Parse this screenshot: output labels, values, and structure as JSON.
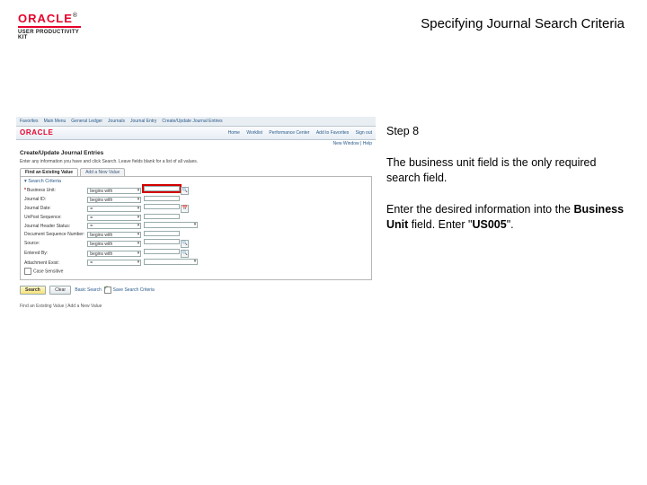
{
  "header": {
    "brand": "ORACLE",
    "kit": "USER PRODUCTIVITY KIT",
    "title": "Specifying Journal Search Criteria"
  },
  "instructions": {
    "step_label": "Step 8",
    "para1": "The business unit field is the only required search field.",
    "para2_a": "Enter the desired information into the ",
    "para2_field": "Business Unit",
    "para2_b": " field. Enter \"",
    "para2_value": "US005",
    "para2_c": "\"."
  },
  "shot": {
    "breadcrumb": [
      "Favorites",
      "Main Menu",
      "General Ledger",
      "Journals",
      "Journal Entry",
      "Create/Update Journal Entries"
    ],
    "brand": "ORACLE",
    "rnav": [
      "Home",
      "Worklist",
      "Performance Center",
      "Add to Favorites",
      "Sign out"
    ],
    "new_window": "New Window | Help",
    "page_title": "Create/Update Journal Entries",
    "sub": "Enter any information you have and click Search. Leave fields blank for a list of all values.",
    "tabs": [
      "Find an Existing Value",
      "Add a New Value"
    ],
    "panel": "Search Criteria",
    "labels": {
      "bu": "Business Unit:",
      "jid": "Journal ID:",
      "jdt": "Journal Date:",
      "ub": "UnPost Sequence:",
      "hs": "Journal Header Status:",
      "bds": "Document Sequence Number:",
      "src": "Source:",
      "eby": "Entered By:",
      "att": "Attachment Exist:",
      "cs": "Case Sensitive"
    },
    "ops": {
      "eq": "=",
      "bw": "begins with"
    },
    "vals": {
      "bu": "",
      "jid": "",
      "jdt": "",
      "ub": "",
      "hs": "",
      "bds": "",
      "src": "",
      "eby": "",
      "att": ""
    },
    "buttons": {
      "search": "Search",
      "clear": "Clear",
      "basic": "Basic Search",
      "save": "Save Search Criteria"
    },
    "footer": "Find an Existing Value | Add a New Value"
  }
}
